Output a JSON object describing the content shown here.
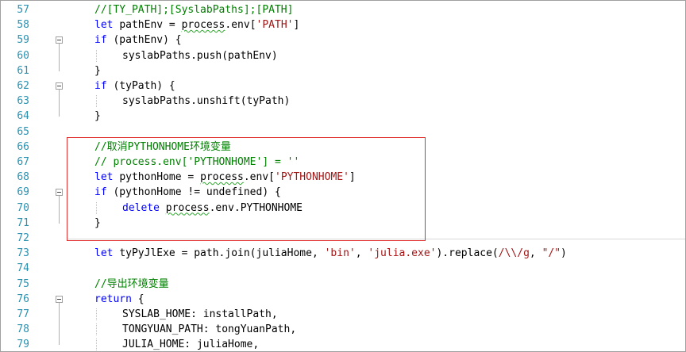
{
  "editor": {
    "lines": [
      {
        "n": "57",
        "indent": 1,
        "fold": false,
        "segs": [
          {
            "t": "cm",
            "v": "//[TY_PATH];[SyslabPaths];[PATH]"
          }
        ]
      },
      {
        "n": "58",
        "indent": 1,
        "fold": false,
        "segs": [
          {
            "t": "kw",
            "v": "let "
          },
          {
            "t": "plain",
            "v": "pathEnv = "
          },
          {
            "t": "sq",
            "v": "process"
          },
          {
            "t": "plain",
            "v": ".env["
          },
          {
            "t": "str",
            "v": "'PATH'"
          },
          {
            "t": "plain",
            "v": "]"
          }
        ]
      },
      {
        "n": "59",
        "indent": 1,
        "fold": true,
        "segs": [
          {
            "t": "kw",
            "v": "if "
          },
          {
            "t": "plain",
            "v": "(pathEnv) {"
          }
        ]
      },
      {
        "n": "60",
        "indent": 2,
        "fold": false,
        "segs": [
          {
            "t": "plain",
            "v": "syslabPaths.push(pathEnv)"
          }
        ]
      },
      {
        "n": "61",
        "indent": 1,
        "fold": false,
        "segs": [
          {
            "t": "plain",
            "v": "}"
          }
        ]
      },
      {
        "n": "62",
        "indent": 1,
        "fold": true,
        "segs": [
          {
            "t": "kw",
            "v": "if "
          },
          {
            "t": "plain",
            "v": "(tyPath) {"
          }
        ]
      },
      {
        "n": "63",
        "indent": 2,
        "fold": false,
        "segs": [
          {
            "t": "plain",
            "v": "syslabPaths.unshift(tyPath)"
          }
        ]
      },
      {
        "n": "64",
        "indent": 1,
        "fold": false,
        "segs": [
          {
            "t": "plain",
            "v": "}"
          }
        ]
      },
      {
        "n": "65",
        "indent": 1,
        "fold": false,
        "segs": []
      },
      {
        "n": "66",
        "indent": 1,
        "fold": false,
        "segs": [
          {
            "t": "cm",
            "v": "//取消PYTHONHOME环境变量"
          }
        ]
      },
      {
        "n": "67",
        "indent": 1,
        "fold": false,
        "segs": [
          {
            "t": "cm",
            "v": "// process.env['PYTHONHOME'] = ''"
          }
        ]
      },
      {
        "n": "68",
        "indent": 1,
        "fold": false,
        "segs": [
          {
            "t": "kw",
            "v": "let "
          },
          {
            "t": "plain",
            "v": "pythonHome = "
          },
          {
            "t": "sq",
            "v": "process"
          },
          {
            "t": "plain",
            "v": ".env["
          },
          {
            "t": "str",
            "v": "'PYTHONHOME'"
          },
          {
            "t": "plain",
            "v": "]"
          }
        ]
      },
      {
        "n": "69",
        "indent": 1,
        "fold": true,
        "segs": [
          {
            "t": "kw",
            "v": "if "
          },
          {
            "t": "plain",
            "v": "(pythonHome != undefined) {"
          }
        ]
      },
      {
        "n": "70",
        "indent": 2,
        "fold": false,
        "segs": [
          {
            "t": "kw",
            "v": "delete "
          },
          {
            "t": "sq",
            "v": "process"
          },
          {
            "t": "plain",
            "v": ".env.PYTHONHOME"
          }
        ]
      },
      {
        "n": "71",
        "indent": 1,
        "fold": false,
        "segs": [
          {
            "t": "plain",
            "v": "}"
          }
        ]
      },
      {
        "n": "72",
        "indent": 1,
        "fold": false,
        "segs": []
      },
      {
        "n": "73",
        "indent": 1,
        "fold": false,
        "segs": [
          {
            "t": "kw",
            "v": "let "
          },
          {
            "t": "plain",
            "v": "tyPyJlExe = path.join(juliaHome, "
          },
          {
            "t": "str",
            "v": "'bin'"
          },
          {
            "t": "plain",
            "v": ", "
          },
          {
            "t": "str",
            "v": "'julia.exe'"
          },
          {
            "t": "plain",
            "v": ").replace("
          },
          {
            "t": "str",
            "v": "/\\\\/g"
          },
          {
            "t": "plain",
            "v": ", "
          },
          {
            "t": "str",
            "v": "\"/\""
          },
          {
            "t": "plain",
            "v": ")"
          }
        ]
      },
      {
        "n": "74",
        "indent": 1,
        "fold": false,
        "segs": []
      },
      {
        "n": "75",
        "indent": 1,
        "fold": false,
        "segs": [
          {
            "t": "cm",
            "v": "//导出环境变量"
          }
        ]
      },
      {
        "n": "76",
        "indent": 1,
        "fold": true,
        "segs": [
          {
            "t": "kw",
            "v": "return "
          },
          {
            "t": "plain",
            "v": "{"
          }
        ]
      },
      {
        "n": "77",
        "indent": 2,
        "fold": false,
        "segs": [
          {
            "t": "plain",
            "v": "SYSLAB_HOME: installPath,"
          }
        ]
      },
      {
        "n": "78",
        "indent": 2,
        "fold": false,
        "segs": [
          {
            "t": "plain",
            "v": "TONGYUAN_PATH: tongYuanPath,"
          }
        ]
      },
      {
        "n": "79",
        "indent": 2,
        "fold": false,
        "segs": [
          {
            "t": "plain",
            "v": "JULIA_HOME: juliaHome,"
          }
        ]
      }
    ]
  },
  "colors": {
    "comment": "#008000",
    "keyword": "#0000ff",
    "string": "#a31515",
    "line_number": "#2b91af",
    "highlight_box": "#e03030"
  }
}
